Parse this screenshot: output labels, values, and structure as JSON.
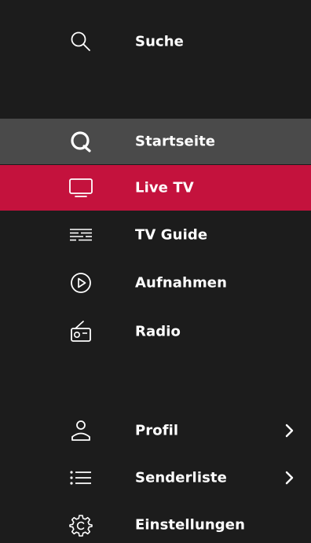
{
  "colors": {
    "background": "#1c1c1c",
    "home_highlight": "#4a4a4a",
    "active_highlight": "#c4123d",
    "text": "#ffffff"
  },
  "menu": {
    "search": {
      "label": "Suche",
      "icon": "search-icon"
    },
    "items": [
      {
        "label": "Startseite",
        "icon": "home-q-icon",
        "state": "highlighted"
      },
      {
        "label": "Live TV",
        "icon": "tv-icon",
        "state": "active"
      },
      {
        "label": "TV Guide",
        "icon": "guide-icon"
      },
      {
        "label": "Aufnahmen",
        "icon": "play-circle-icon"
      },
      {
        "label": "Radio",
        "icon": "radio-icon"
      }
    ],
    "bottom_items": [
      {
        "label": "Profil",
        "icon": "profile-icon",
        "has_submenu": true
      },
      {
        "label": "Senderliste",
        "icon": "channel-list-icon",
        "has_submenu": true
      },
      {
        "label": "Einstellungen",
        "icon": "settings-gear-icon",
        "has_submenu": false
      }
    ]
  }
}
